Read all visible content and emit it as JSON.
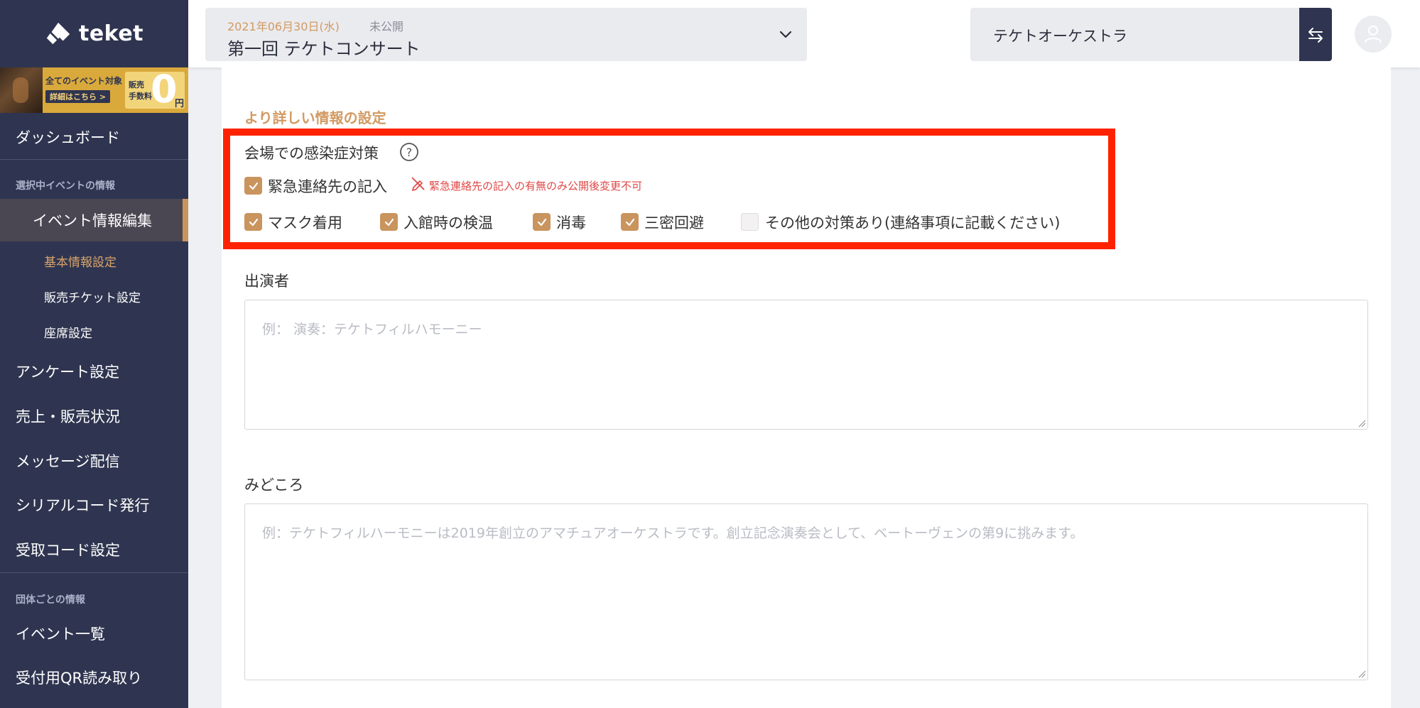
{
  "brand": {
    "name": "teket"
  },
  "banner": {
    "line1": "全てのイベント対象",
    "line2": "詳細はこちら >",
    "fee_line1": "販売",
    "fee_line2": "手数料",
    "zero": "0",
    "yen": "円"
  },
  "sidebar": {
    "dashboard": "ダッシュボード",
    "section_event": "選択中イベントの情報",
    "event_edit": "イベント情報編集",
    "sub_basic": "基本情報設定",
    "sub_ticket": "販売チケット設定",
    "sub_seat": "座席設定",
    "survey": "アンケート設定",
    "sales": "売上・販売状況",
    "message": "メッセージ配信",
    "serial": "シリアルコード発行",
    "receipt": "受取コード設定",
    "section_org": "団体ごとの情報",
    "event_list": "イベント一覧",
    "qr_reader": "受付用QR読み取り"
  },
  "header": {
    "event_date": "2021年06月30日(水)",
    "event_status": "未公開",
    "event_title": "第一回 テケトコンサート",
    "org_name": "テケトオーケストラ"
  },
  "form": {
    "section_title": "より詳しい情報の設定",
    "infection_label": "会場での感染症対策",
    "emergency_label": "緊急連絡先の記入",
    "emergency_checked": true,
    "warning_text": "緊急連絡先の記入の有無のみ公開後変更不可",
    "measures": [
      {
        "label": "マスク着用",
        "checked": true
      },
      {
        "label": "入館時の検温",
        "checked": true
      },
      {
        "label": "消毒",
        "checked": true
      },
      {
        "label": "三密回避",
        "checked": true
      },
      {
        "label": "その他の対策あり(連絡事項に記載ください)",
        "checked": false
      }
    ],
    "performers_label": "出演者",
    "performers_placeholder": "例： 演奏：テケトフィルハモーニー",
    "highlights_label": "みどころ",
    "highlights_placeholder": "例：テケトフィルハーモニーは2019年創立のアマチュアオーケストラです。創立記念演奏会として、ベートーヴェンの第9に挑みます。"
  },
  "colors": {
    "sidebar_bg": "#2f3550",
    "accent": "#c9945d",
    "highlight_border": "#ff2200",
    "warning": "#e04848"
  }
}
